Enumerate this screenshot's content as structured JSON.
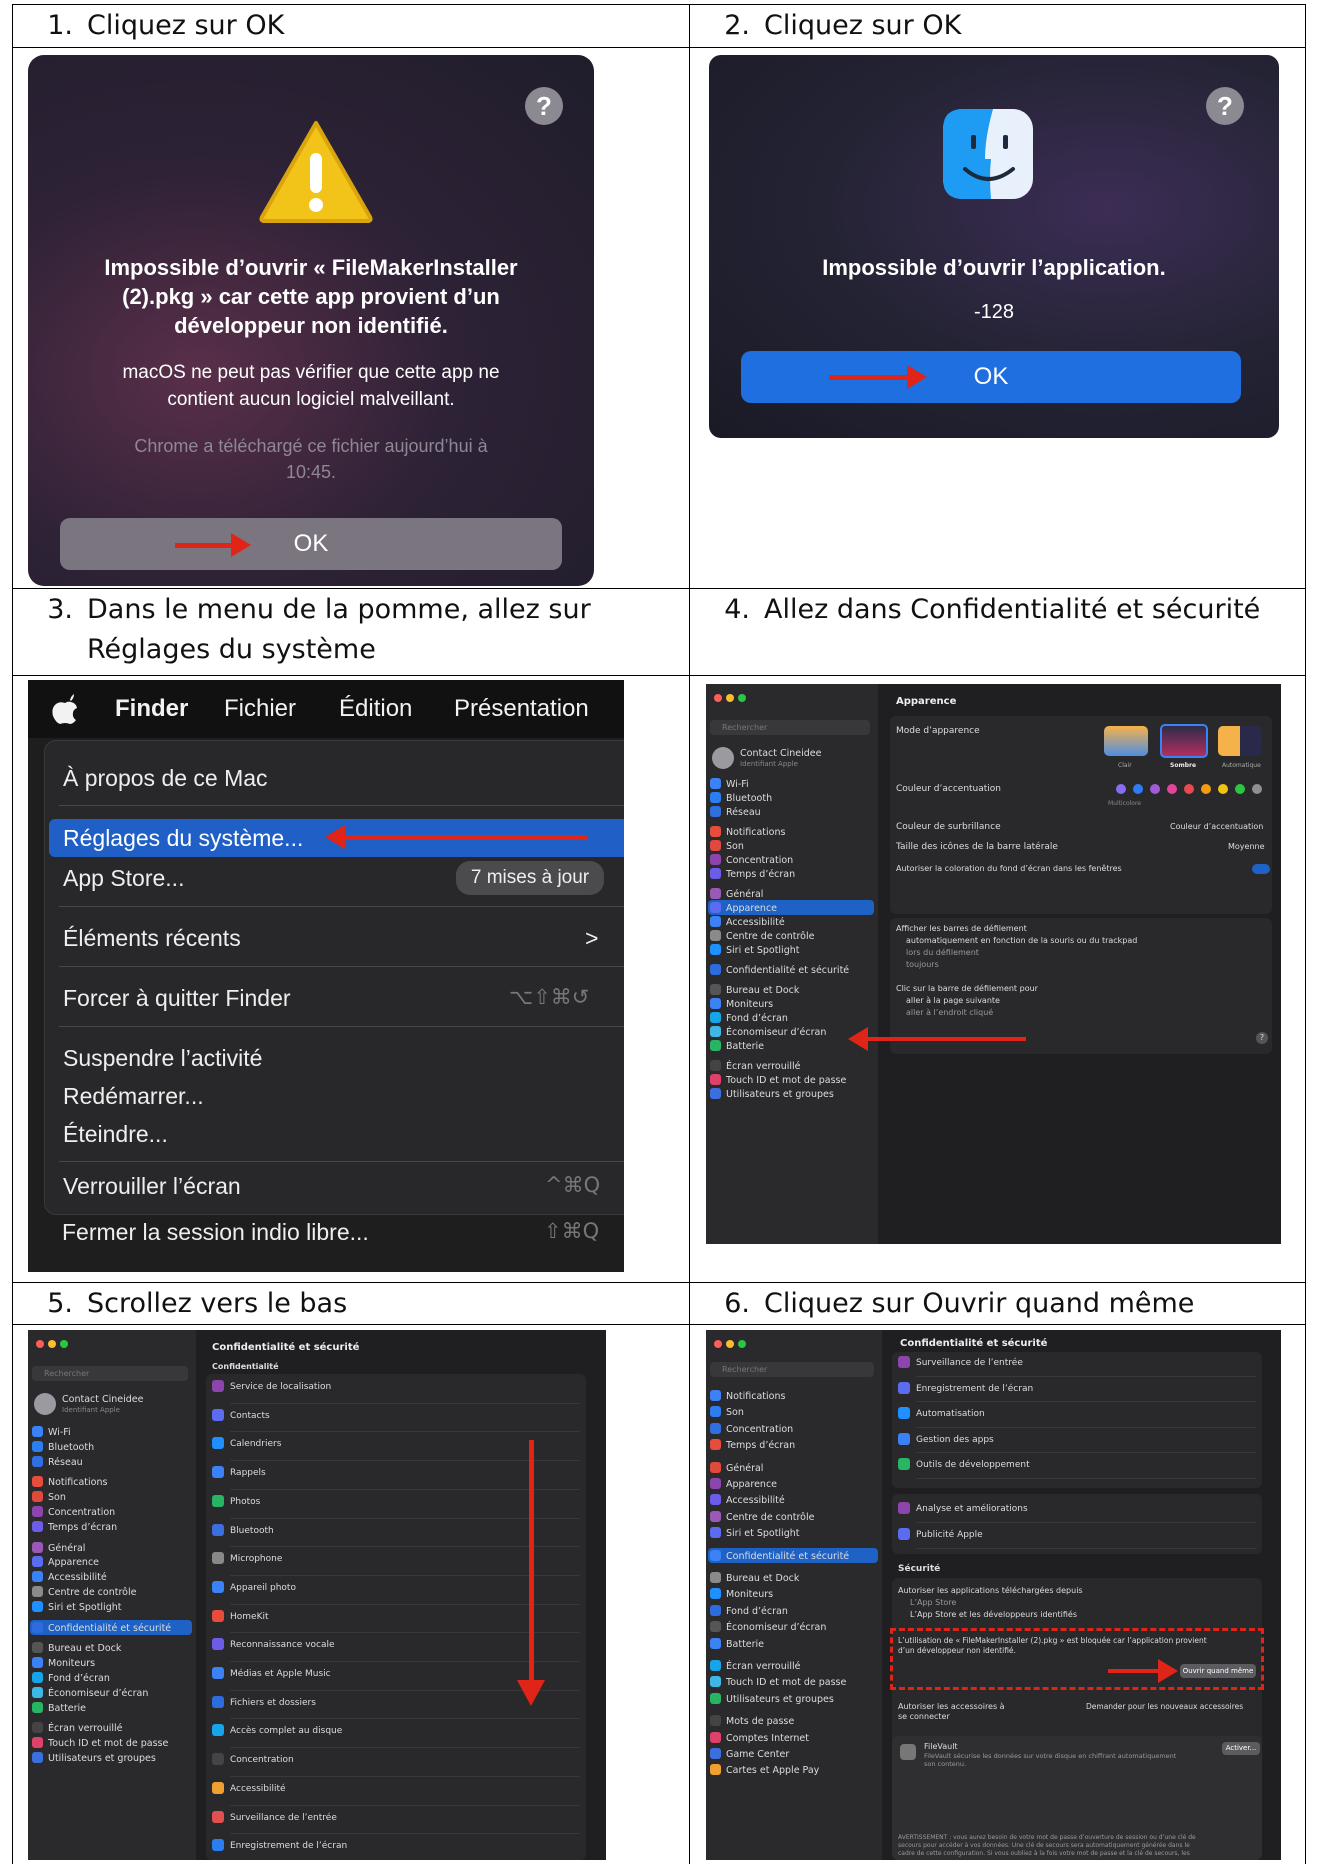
{
  "steps": [
    {
      "num": "1.",
      "text": "Cliquez sur OK"
    },
    {
      "num": "2.",
      "text": "Cliquez sur OK"
    },
    {
      "num": "3.",
      "text": "Dans le menu de la pomme, allez sur",
      "text2": "Réglages du système"
    },
    {
      "num": "4.",
      "text": "Allez dans Confidentialité et sécurité"
    },
    {
      "num": "5.",
      "text": "Scrollez vers le bas"
    },
    {
      "num": "6.",
      "text": "Cliquez sur Ouvrir quand même"
    }
  ],
  "dialog1": {
    "help": "?",
    "title": [
      "Impossible d’ouvrir « FileMakerInstaller",
      "(2).pkg » car cette app provient d’un",
      "développeur non identifié."
    ],
    "body": [
      "macOS ne peut pas vérifier que cette app ne",
      "contient aucun logiciel malveillant."
    ],
    "note": [
      "Chrome a téléchargé ce fichier aujourd’hui à",
      "10:45."
    ],
    "ok": "OK"
  },
  "dialog2": {
    "help": "?",
    "title": "Impossible d’ouvrir l’application.",
    "code": "-128",
    "ok": "OK"
  },
  "menu": {
    "bar": [
      "Finder",
      "Fichier",
      "Édition",
      "Présentation"
    ],
    "items": {
      "about": "À propos de ce Mac",
      "settings": "Réglages du système...",
      "appstore": "App Store...",
      "updates": "7 mises à jour",
      "recent": "Éléments récents",
      "recent_arrow": ">",
      "force": "Forcer à quitter Finder",
      "force_sc": "⌥⇧⌘↺",
      "sleep": "Suspendre l’activité",
      "restart": "Redémarrer...",
      "shutdown": "Éteindre...",
      "lock": "Verrouiller l’écran",
      "lock_sc": "^⌘Q",
      "logout": "Fermer la session indio libre...",
      "logout_sc": "⇧⌘Q"
    }
  },
  "settings4": {
    "search": "Rechercher",
    "user": "Contact Cineidee",
    "user_sub": "Identifiant Apple",
    "title": "Apparence",
    "sidebar": [
      "Wi-Fi",
      "Bluetooth",
      "Réseau",
      "Notifications",
      "Son",
      "Concentration",
      "Temps d’écran",
      "Général",
      "Apparence",
      "Accessibilité",
      "Centre de contrôle",
      "Siri et Spotlight",
      "Confidentialité et sécurité",
      "Bureau et Dock",
      "Moniteurs",
      "Fond d’écran",
      "Économiseur d’écran",
      "Batterie",
      "Écran verrouillé",
      "Touch ID et mot de passe",
      "Utilisateurs et groupes"
    ],
    "mode_label": "Mode d’apparence",
    "modes": [
      "Clair",
      "Sombre",
      "Automatique"
    ],
    "accent_label": "Couleur d’accentuation",
    "accent_sub": "Multicolore",
    "highlight_label": "Couleur de surbrillance",
    "highlight_val": "Couleur d’accentuation",
    "icons_label": "Taille des icônes de la barre latérale",
    "icons_val": "Moyenne",
    "tint_label": "Autoriser la coloration du fond d’écran dans les fenêtres",
    "scroll_label": "Afficher les barres de défilement",
    "scroll_opts": [
      "automatiquement en fonction de la souris ou du trackpad",
      "lors du défilement",
      "toujours"
    ],
    "click_label": "Clic sur la barre de défilement pour",
    "click_opts": [
      "aller à la page suivante",
      "aller à l’endroit cliqué"
    ],
    "help": "?"
  },
  "settings5": {
    "search": "Rechercher",
    "user": "Contact Cineidee",
    "user_sub": "Identifiant Apple",
    "title": "Confidentialité et sécurité",
    "section": "Confidentialité",
    "sidebar": [
      "Wi-Fi",
      "Bluetooth",
      "Réseau",
      "Notifications",
      "Son",
      "Concentration",
      "Temps d’écran",
      "Général",
      "Apparence",
      "Accessibilité",
      "Centre de contrôle",
      "Siri et Spotlight",
      "Confidentialité et sécurité",
      "Bureau et Dock",
      "Moniteurs",
      "Fond d’écran",
      "Économiseur d’écran",
      "Batterie",
      "Écran verrouillé",
      "Touch ID et mot de passe",
      "Utilisateurs et groupes"
    ],
    "rows": [
      "Service de localisation",
      "Contacts",
      "Calendriers",
      "Rappels",
      "Photos",
      "Bluetooth",
      "Microphone",
      "Appareil photo",
      "HomeKit",
      "Reconnaissance vocale",
      "Médias et Apple Music",
      "Fichiers et dossiers",
      "Accès complet au disque",
      "Concentration",
      "Accessibilité",
      "Surveillance de l’entrée",
      "Enregistrement de l’écran"
    ]
  },
  "settings6": {
    "search": "Rechercher",
    "title": "Confidentialité et sécurité",
    "sidebar": [
      "Notifications",
      "Son",
      "Concentration",
      "Temps d’écran",
      "Général",
      "Apparence",
      "Accessibilité",
      "Centre de contrôle",
      "Siri et Spotlight",
      "Confidentialité et sécurité",
      "Bureau et Dock",
      "Moniteurs",
      "Fond d’écran",
      "Économiseur d’écran",
      "Batterie",
      "Écran verrouillé",
      "Touch ID et mot de passe",
      "Utilisateurs et groupes",
      "Mots de passe",
      "Comptes Internet",
      "Game Center",
      "Cartes et Apple Pay"
    ],
    "rows_a": [
      "Surveillance de l’entrée",
      "Enregistrement de l’écran",
      "Automatisation",
      "Gestion des apps",
      "Outils de développement"
    ],
    "rows_b": [
      "Analyse et améliorations",
      "Publicité Apple"
    ],
    "security": "Sécurité",
    "allow_label": "Autoriser les applications téléchargées depuis",
    "allow_opts": [
      "L’App Store",
      "L’App Store et les développeurs identifiés"
    ],
    "blocked": [
      "L’utilisation de « FileMakerInstaller (2).pkg » est bloquée car l’application provient",
      "d’un développeur non identifié."
    ],
    "open_btn": "Ouvrir quand même",
    "acc_label": [
      "Autoriser les accessoires à",
      "se connecter"
    ],
    "acc_val": "Demander pour les nouveaux accessoires",
    "filevault": "FileVault",
    "filevault_desc": [
      "FileVault sécurise les données sur votre disque en chiffrant automatiquement",
      "son contenu."
    ],
    "activate": "Activer...",
    "warning": [
      "AVERTISSEMENT : vous aurez besoin de votre mot de passe d’ouverture de session ou d’une clé de",
      "secours pour accéder à vos données. Une clé de secours sera automatiquement générée dans le",
      "cadre de cette configuration. Si vous oubliez à la fois votre mot de passe et la clé de secours, les"
    ]
  },
  "colors": {
    "accent": "#1d62c4",
    "arrow": "#e02418",
    "ok_blue": "#1f6fe0"
  }
}
